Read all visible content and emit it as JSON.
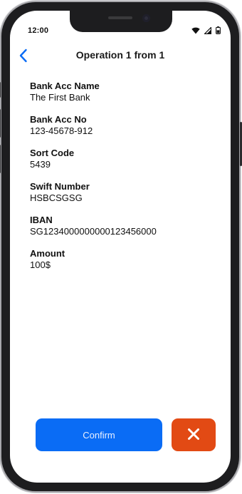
{
  "status_bar": {
    "time": "12:00",
    "icons": [
      "wifi-icon",
      "cellular-signal-icon",
      "battery-icon"
    ]
  },
  "header": {
    "back_icon": "chevron-left-icon",
    "title": "Operation 1 from 1"
  },
  "fields": [
    {
      "label": "Bank Acc Name",
      "value": "The First Bank"
    },
    {
      "label": "Bank Acc No",
      "value": "123-45678-912"
    },
    {
      "label": "Sort Code",
      "value": "5439"
    },
    {
      "label": "Swift Number",
      "value": "HSBCSGSG"
    },
    {
      "label": "IBAN",
      "value": "SG1234000000000123456000"
    },
    {
      "label": "Amount",
      "value": "100$"
    }
  ],
  "actions": {
    "confirm_label": "Confirm",
    "cancel_icon": "close-icon"
  },
  "colors": {
    "accent": "#0a6cf5",
    "cancel": "#e24a14",
    "back_chevron": "#0a6cf5"
  }
}
